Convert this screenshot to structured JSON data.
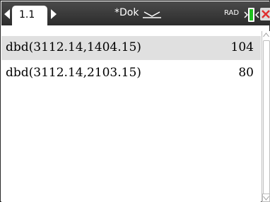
{
  "titlebar": {
    "tab_label": "1.1",
    "doc_title": "*Dok",
    "mode": "RAD"
  },
  "history": [
    {
      "expression": "dbd(3112.14,1404.15)",
      "result": "104"
    },
    {
      "expression": "dbd(3112.14,2103.15)",
      "result": "80"
    }
  ],
  "icons": {
    "prev_page": "chevron-left-icon",
    "next_page": "chevron-right-icon",
    "doc_menu": "chevron-down-icon",
    "battery": "battery-icon",
    "close": "close-icon",
    "scroll_up": "scroll-up-icon",
    "scroll_down": "scroll-down-icon"
  },
  "colors": {
    "titlebar": "#3a3a3a",
    "selected_row": "#e0e0e0",
    "battery": "#20c020",
    "close_x": "#e03030"
  }
}
